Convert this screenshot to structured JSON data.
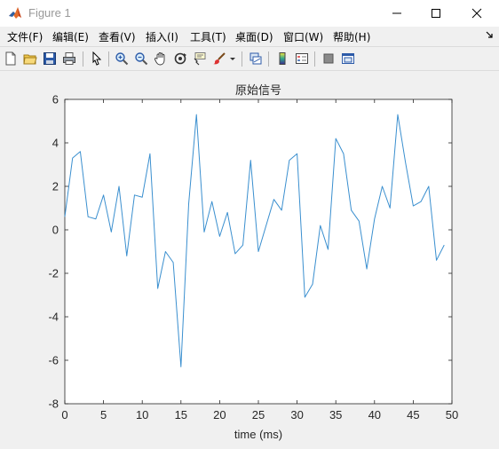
{
  "window": {
    "title": "Figure 1",
    "minimize_glyph": "—",
    "maximize_glyph": "☐",
    "close_glyph": "✕"
  },
  "menu": {
    "items": [
      "文件(F)",
      "编辑(E)",
      "查看(V)",
      "插入(I)",
      "工具(T)",
      "桌面(D)",
      "窗口(W)",
      "帮助(H)"
    ]
  },
  "toolbar": {
    "icons": [
      "new-figure-icon",
      "open-file-icon",
      "save-icon",
      "print-icon",
      "pointer-icon",
      "zoom-in-icon",
      "zoom-out-icon",
      "pan-hand-icon",
      "rotate-3d-icon",
      "data-cursor-icon",
      "brush-icon",
      "brush-dropdown-icon",
      "link-plot-icon",
      "colorbar-icon",
      "legend-icon",
      "hide-plot-tools-icon",
      "show-plot-tools-icon"
    ]
  },
  "colors": {
    "line": "#3a8fcf",
    "axes_bg": "#ffffff",
    "figure_bg": "#f0f0f0",
    "axis": "#262626"
  },
  "chart_data": {
    "type": "line",
    "title": "原始信号",
    "xlabel": "time (ms)",
    "ylabel": "",
    "xlim": [
      0,
      50
    ],
    "ylim": [
      -8,
      6
    ],
    "xticks": [
      0,
      5,
      10,
      15,
      20,
      25,
      30,
      35,
      40,
      45,
      50
    ],
    "yticks": [
      -8,
      -6,
      -4,
      -2,
      0,
      2,
      4,
      6
    ],
    "grid": false,
    "legend": "none",
    "series": [
      {
        "x": [
          0,
          1,
          2,
          3,
          4,
          5,
          6,
          7,
          8,
          9,
          10,
          11,
          12,
          13,
          14,
          15,
          16,
          17,
          18,
          19,
          20,
          21,
          22,
          23,
          24,
          25,
          26,
          27,
          28,
          29,
          30,
          31,
          32,
          33,
          34,
          35,
          36,
          37,
          38,
          39,
          40,
          41,
          42,
          43,
          44,
          45,
          46,
          47,
          48,
          49
        ],
        "values": [
          0.6,
          3.3,
          3.6,
          0.6,
          0.5,
          1.6,
          -0.1,
          2.0,
          -1.2,
          1.6,
          1.5,
          3.5,
          -2.7,
          -1.0,
          -1.5,
          -6.3,
          1.2,
          5.3,
          -0.1,
          1.3,
          -0.3,
          0.8,
          -1.1,
          -0.7,
          3.2,
          -1.0,
          0.2,
          1.4,
          0.9,
          3.2,
          3.5,
          -3.1,
          -2.5,
          0.2,
          -0.9,
          4.2,
          3.5,
          0.9,
          0.4,
          -1.8,
          0.5,
          2.0,
          1.0,
          5.3,
          3.1,
          1.1,
          1.3,
          2.0,
          -1.4,
          -0.7
        ]
      }
    ]
  }
}
